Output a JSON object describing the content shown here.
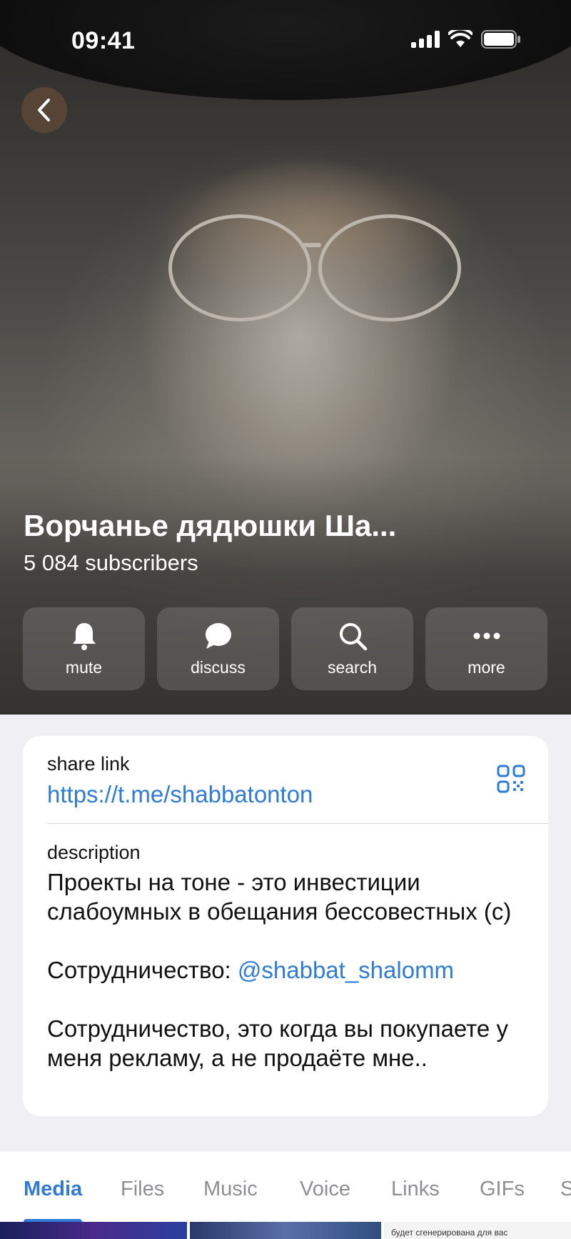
{
  "status_bar": {
    "time": "09:41"
  },
  "channel": {
    "title": "Ворчанье дядюшки Ша...",
    "subscribers": "5 084 subscribers"
  },
  "actions": [
    {
      "label": "mute",
      "icon": "bell-icon"
    },
    {
      "label": "discuss",
      "icon": "chat-bubble-icon"
    },
    {
      "label": "search",
      "icon": "search-icon"
    },
    {
      "label": "more",
      "icon": "more-dots-icon"
    }
  ],
  "info": {
    "share_label": "share link",
    "share_url": "https://t.me/shabbatonton",
    "description_label": "description",
    "description_line1": "Проекты на тоне - это инвестиции слабоумных в обещания бессовестных (с)",
    "cooperation_prefix": "Сотрудничество: ",
    "cooperation_mention": "@shabbat_shalomm",
    "description_line3": "Сотрудничество, это когда вы покупаете у меня рекламу, а не продаёте мне.."
  },
  "tabs": [
    "Media",
    "Files",
    "Music",
    "Voice",
    "Links",
    "GIFs",
    "S"
  ],
  "active_tab": "Media",
  "thumbnail_caption": "будет сгенерирована для вас",
  "colors": {
    "accent": "#2f7bd6",
    "background": "#efeff4"
  }
}
